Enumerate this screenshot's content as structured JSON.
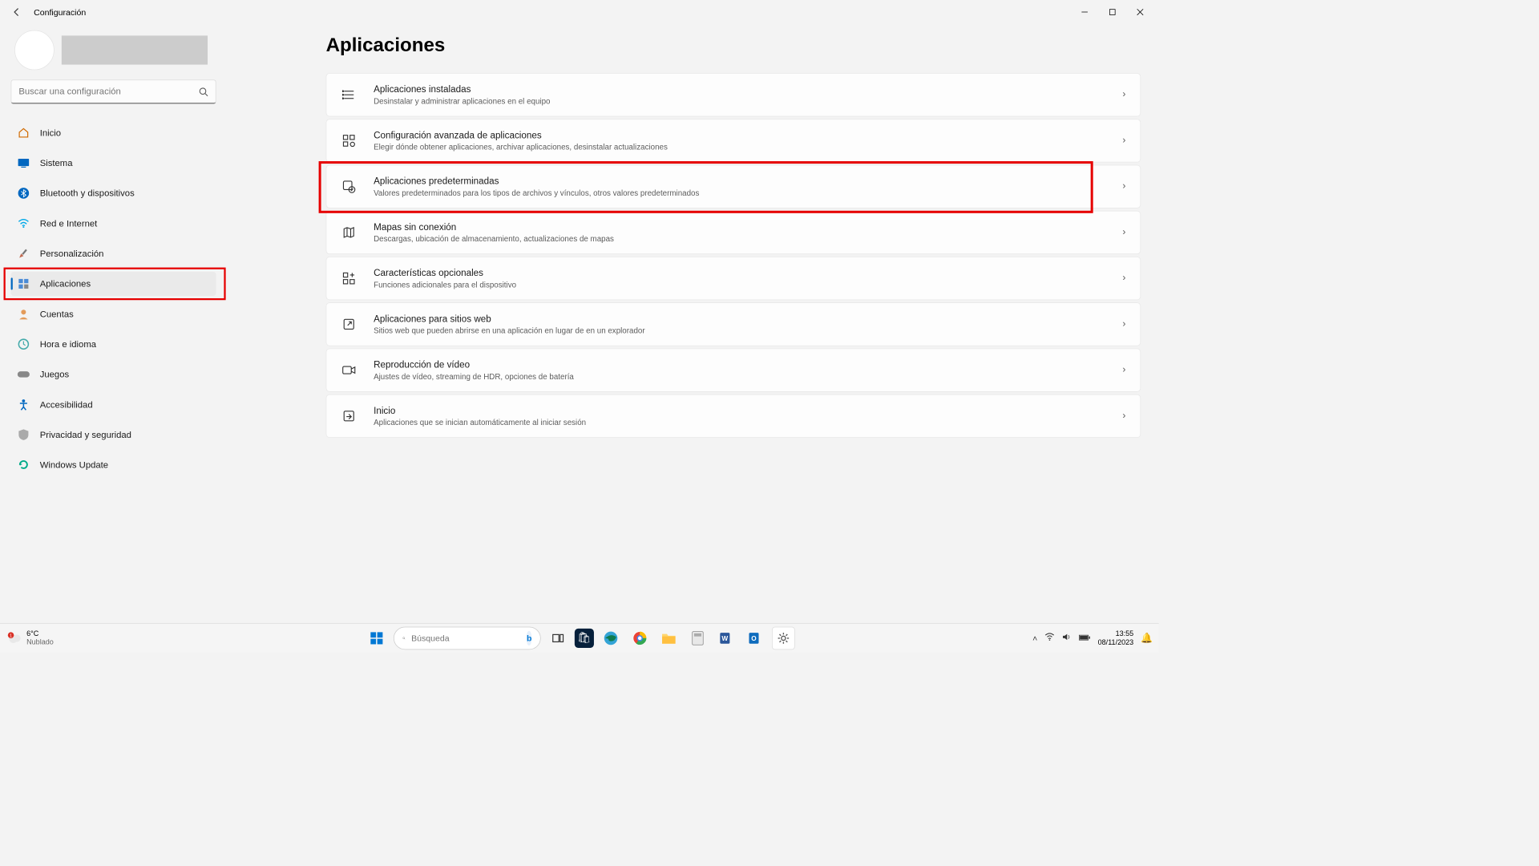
{
  "window": {
    "title": "Configuración"
  },
  "search": {
    "placeholder": "Buscar una configuración"
  },
  "nav": [
    {
      "label": "Inicio"
    },
    {
      "label": "Sistema"
    },
    {
      "label": "Bluetooth y dispositivos"
    },
    {
      "label": "Red e Internet"
    },
    {
      "label": "Personalización"
    },
    {
      "label": "Aplicaciones"
    },
    {
      "label": "Cuentas"
    },
    {
      "label": "Hora e idioma"
    },
    {
      "label": "Juegos"
    },
    {
      "label": "Accesibilidad"
    },
    {
      "label": "Privacidad y seguridad"
    },
    {
      "label": "Windows Update"
    }
  ],
  "page": {
    "title": "Aplicaciones",
    "cards": [
      {
        "title": "Aplicaciones instaladas",
        "desc": "Desinstalar y administrar aplicaciones en el equipo"
      },
      {
        "title": "Configuración avanzada de aplicaciones",
        "desc": "Elegir dónde obtener aplicaciones, archivar aplicaciones, desinstalar actualizaciones"
      },
      {
        "title": "Aplicaciones predeterminadas",
        "desc": "Valores predeterminados para los tipos de archivos y vínculos, otros valores predeterminados"
      },
      {
        "title": "Mapas sin conexión",
        "desc": "Descargas, ubicación de almacenamiento, actualizaciones de mapas"
      },
      {
        "title": "Características opcionales",
        "desc": "Funciones adicionales para el dispositivo"
      },
      {
        "title": "Aplicaciones para sitios web",
        "desc": "Sitios web que pueden abrirse en una aplicación en lugar de en un explorador"
      },
      {
        "title": "Reproducción de vídeo",
        "desc": "Ajustes de vídeo, streaming de HDR, opciones de batería"
      },
      {
        "title": "Inicio",
        "desc": "Aplicaciones que se inician automáticamente al iniciar sesión"
      }
    ]
  },
  "taskbar": {
    "weather_temp": "6°C",
    "weather_cond": "Nublado",
    "search_placeholder": "Búsqueda",
    "time": "13:55",
    "date": "08/11/2023"
  }
}
